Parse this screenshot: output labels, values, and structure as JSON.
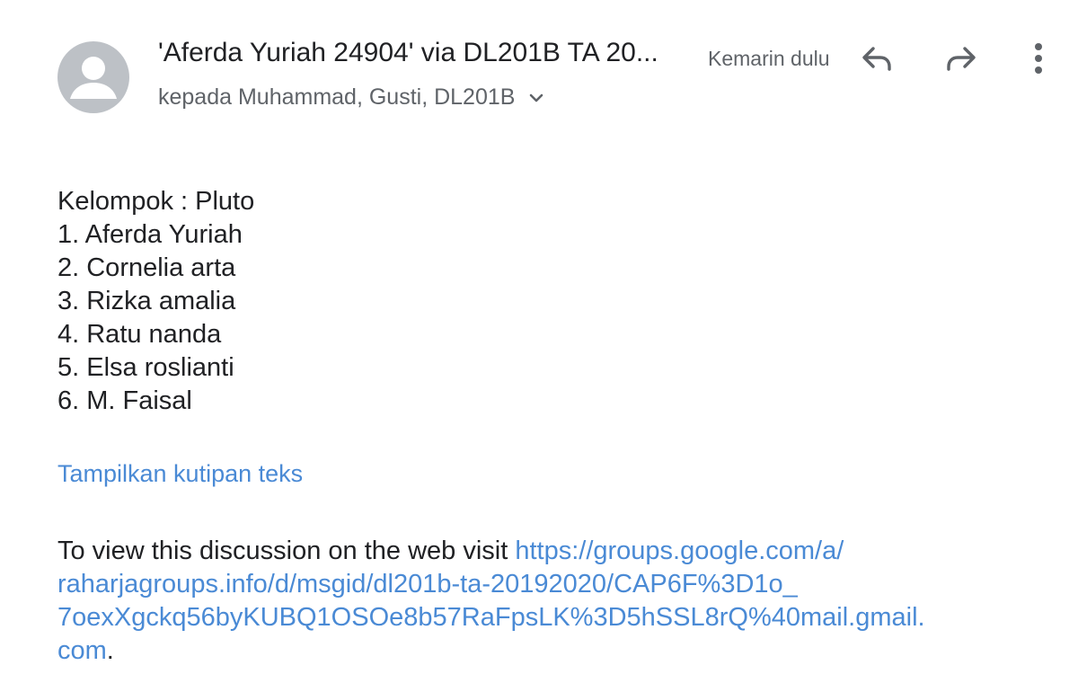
{
  "header": {
    "sender": "'Aferda Yuriah 24904' via DL201B TA 20...",
    "time": "Kemarin dulu",
    "recipients": "kepada Muhammad, Gusti, DL201B",
    "icons": {
      "avatar": "person-avatar-icon",
      "reply": "reply-icon",
      "forward": "forward-icon",
      "more": "more-vert-icon",
      "expand": "chevron-down-icon"
    }
  },
  "body": {
    "lines": [
      "Kelompok : Pluto",
      "1. Aferda Yuriah",
      "2. Cornelia arta",
      "3. Rizka amalia",
      "4. Ratu nanda",
      "5. Elsa roslianti",
      "6. M. Faisal"
    ]
  },
  "quoted_link": "Tampilkan kutipan teks",
  "footer": {
    "prefix": "To view this discussion on the web visit ",
    "link_line_1": "https://groups.google.com/a/",
    "link_line_2": "raharjagroups.info/d/msgid/dl201b-ta-20192020/CAP6F%3D1o_",
    "link_line_3": "7oexXgckq56byKUBQ1OSOe8b57RaFpsLK%3D5hSSL8rQ%40mail.gmail.",
    "link_line_4": "com",
    "suffix": "."
  },
  "colors": {
    "link": "#4a8ad5",
    "text": "#202124",
    "secondary": "#5f6368",
    "avatar_bg": "#bdc1c6"
  }
}
